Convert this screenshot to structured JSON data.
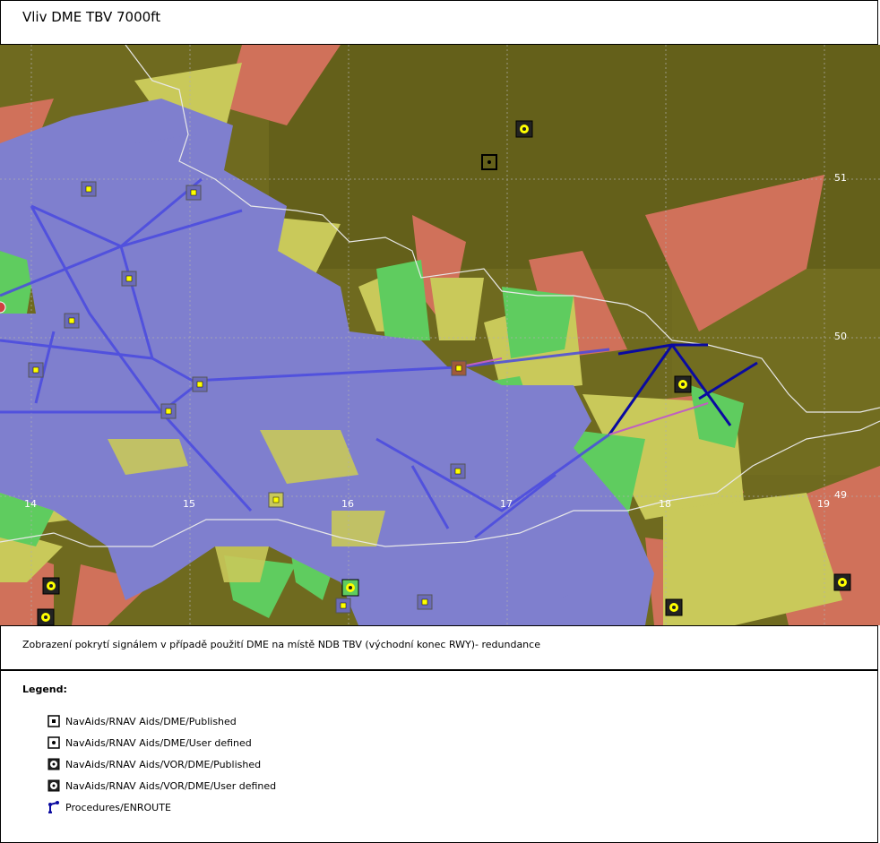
{
  "title": "Vliv DME TBV 7000ft",
  "caption": "Zobrazení pokrytí signálem v případě použití DME na místě NDB TBV (východní konec RWY)- redundance",
  "map": {
    "lon_labels": [
      "14",
      "15",
      "16",
      "17",
      "18",
      "19"
    ],
    "lat_labels": [
      "51",
      "50",
      "49"
    ],
    "colors": {
      "terrain": "#6f6a1f",
      "coverage_blue": "#7f7fce",
      "coverage_green": "#5fcc5f",
      "coverage_yellow": "#c9c95a",
      "coverage_red": "#d0715a",
      "route": "#4a4ae0",
      "route_dark": "#0a0aa0"
    }
  },
  "legend": {
    "title": "Legend:",
    "items": [
      {
        "label": "NavAids/RNAV Aids/DME/Published",
        "icon": "dme-published-icon"
      },
      {
        "label": "NavAids/RNAV Aids/DME/User defined",
        "icon": "dme-user-defined-icon"
      },
      {
        "label": "NavAids/RNAV Aids/VOR/DME/Published",
        "icon": "vor-dme-published-icon"
      },
      {
        "label": "NavAids/RNAV Aids/VOR/DME/User defined",
        "icon": "vor-dme-user-defined-icon"
      },
      {
        "label": "Procedures/ENROUTE",
        "icon": "enroute-procedure-icon"
      }
    ]
  }
}
